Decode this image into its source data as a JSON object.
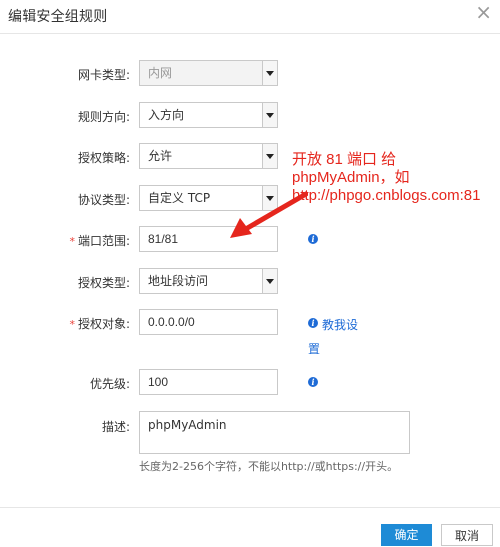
{
  "dialog": {
    "title": "编辑安全组规则",
    "close_glyph": "×"
  },
  "form": {
    "nic_type": {
      "label": "网卡类型:",
      "value": "内网"
    },
    "direction": {
      "label": "规则方向:",
      "value": "入方向"
    },
    "policy": {
      "label": "授权策略:",
      "value": "允许"
    },
    "protocol": {
      "label": "协议类型:",
      "value": "自定义 TCP"
    },
    "port_range": {
      "label": "端口范围:",
      "required": "*",
      "value": "81/81"
    },
    "auth_type": {
      "label": "授权类型:",
      "value": "地址段访问"
    },
    "auth_object": {
      "label": "授权对象:",
      "required": "*",
      "value": "0.0.0.0/0",
      "help_link_line1": "教我设",
      "help_link_line2": "置"
    },
    "priority": {
      "label": "优先级:",
      "value": "100"
    },
    "description": {
      "label": "描述:",
      "value": "phpMyAdmin",
      "hint": "长度为2-256个字符，不能以http://或https://开头。"
    }
  },
  "annotation": {
    "line1": "开放 81 端口 给",
    "line2": "phpMyAdmin，如",
    "line3": "http://phpgo.cnblogs.com:81",
    "color": "#e5261d"
  },
  "footer": {
    "confirm_label": "确定",
    "cancel_label": "取消"
  },
  "icons": {
    "info_glyph": "i"
  },
  "colors": {
    "accent": "#1e8bd6",
    "link": "#1e6bd6",
    "required": "#e9423a"
  }
}
